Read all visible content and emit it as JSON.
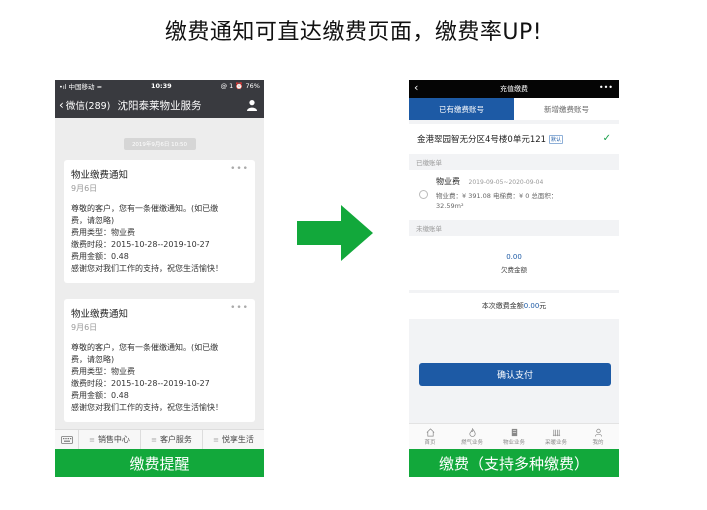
{
  "headline": "缴费通知可直达缴费页面，缴费率UP!",
  "left_phone": {
    "status": {
      "carrier": "•ıl 中国移动 ≈",
      "time": "10:39",
      "battery": "@ 1 ⏰ 76%"
    },
    "nav": {
      "back_label": "微信(289)",
      "title": "沈阳泰莱物业服务",
      "user_icon": "user-icon"
    },
    "time_chip": "2019年9月6日 10:50",
    "messages": [
      {
        "title": "物业缴费通知",
        "date": "9月6日",
        "more": "•••",
        "lines": [
          "尊敬的客户，您有一条催缴通知。(如已缴",
          "费，请忽略)",
          "费用类型：物业费",
          "缴费时段：2015-10-28--2019-10-27",
          "费用金额：0.48",
          "感谢您对我们工作的支持，祝您生活愉快！"
        ]
      },
      {
        "title": "物业缴费通知",
        "date": "9月6日",
        "more": "•••",
        "lines": [
          "尊敬的客户，您有一条催缴通知。(如已缴",
          "费，请忽略)",
          "费用类型：物业费",
          "缴费时段：2015-10-28--2019-10-27",
          "费用金额：0.48",
          "感谢您对我们工作的支持，祝您生活愉快！"
        ]
      }
    ],
    "menu": [
      "销售中心",
      "客户服务",
      "悦享生活"
    ],
    "caption": "缴费提醒"
  },
  "right_phone": {
    "nav": {
      "back": "‹",
      "title": "充值缴费",
      "more": "•••"
    },
    "tabs": [
      {
        "label": "已有缴费账号",
        "active": true
      },
      {
        "label": "新增缴费账号",
        "active": false
      }
    ],
    "address": {
      "text": "金港翠园智无分区4号楼0单元121",
      "badge": "默认"
    },
    "paid_section": "已缴账单",
    "bill": {
      "name": "物业费",
      "period": "2019-09-05~2020-09-04",
      "line": "物业费：¥ 391.08        电梯费：¥ 0        总面积：",
      "area": "32.59m²"
    },
    "unpaid_section": "未缴账单",
    "unpaid": {
      "amount": "0.00",
      "label": "欠费金额"
    },
    "total": {
      "prefix": "本次缴费金额",
      "value": "0.00",
      "suffix": "元"
    },
    "confirm_label": "确认支付",
    "tabbar": [
      "首页",
      "燃气业务",
      "物业业务",
      "采暖业务",
      "我的"
    ],
    "caption": "缴费（支持多种缴费）"
  },
  "colors": {
    "wechat_bar": "#393a3f",
    "green": "#12a83b",
    "blue": "#1d5aa5"
  }
}
